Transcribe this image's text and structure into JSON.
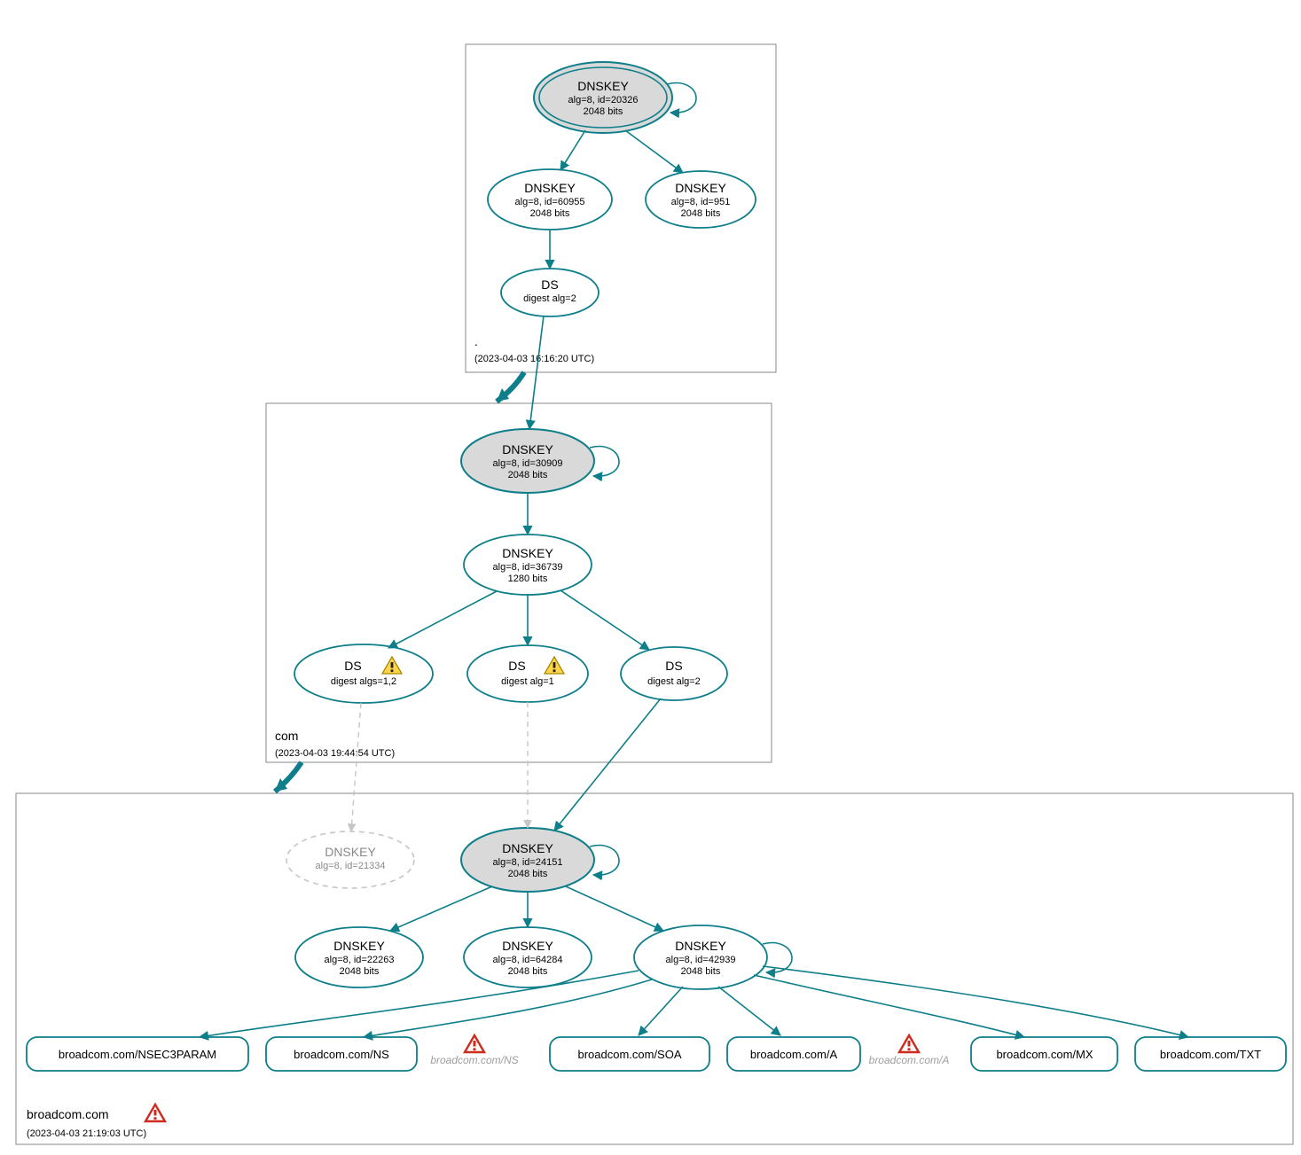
{
  "zones": {
    "root": {
      "label": ".",
      "timestamp": "(2023-04-03 16:16:20 UTC)"
    },
    "com": {
      "label": "com",
      "timestamp": "(2023-04-03 19:44:54 UTC)"
    },
    "broadcom": {
      "label": "broadcom.com",
      "timestamp": "(2023-04-03 21:19:03 UTC)"
    }
  },
  "nodes": {
    "root_ksk": {
      "title": "DNSKEY",
      "line2": "alg=8, id=20326",
      "line3": "2048 bits"
    },
    "root_zsk1": {
      "title": "DNSKEY",
      "line2": "alg=8, id=60955",
      "line3": "2048 bits"
    },
    "root_zsk2": {
      "title": "DNSKEY",
      "line2": "alg=8, id=951",
      "line3": "2048 bits"
    },
    "root_ds": {
      "title": "DS",
      "line2": "digest alg=2"
    },
    "com_ksk": {
      "title": "DNSKEY",
      "line2": "alg=8, id=30909",
      "line3": "2048 bits"
    },
    "com_zsk": {
      "title": "DNSKEY",
      "line2": "alg=8, id=36739",
      "line3": "1280 bits"
    },
    "com_ds1": {
      "title": "DS",
      "line2": "digest algs=1,2"
    },
    "com_ds2": {
      "title": "DS",
      "line2": "digest alg=1"
    },
    "com_ds3": {
      "title": "DS",
      "line2": "digest alg=2"
    },
    "bc_ghost": {
      "title": "DNSKEY",
      "line2": "alg=8, id=21334"
    },
    "bc_ksk": {
      "title": "DNSKEY",
      "line2": "alg=8, id=24151",
      "line3": "2048 bits"
    },
    "bc_zsk1": {
      "title": "DNSKEY",
      "line2": "alg=8, id=22263",
      "line3": "2048 bits"
    },
    "bc_zsk2": {
      "title": "DNSKEY",
      "line2": "alg=8, id=64284",
      "line3": "2048 bits"
    },
    "bc_zsk3": {
      "title": "DNSKEY",
      "line2": "alg=8, id=42939",
      "line3": "2048 bits"
    }
  },
  "rrsets": {
    "nsec3": "broadcom.com/NSEC3PARAM",
    "ns": "broadcom.com/NS",
    "soa": "broadcom.com/SOA",
    "a": "broadcom.com/A",
    "mx": "broadcom.com/MX",
    "txt": "broadcom.com/TXT"
  },
  "ghost_rrsets": {
    "ns": "broadcom.com/NS",
    "a": "broadcom.com/A"
  }
}
